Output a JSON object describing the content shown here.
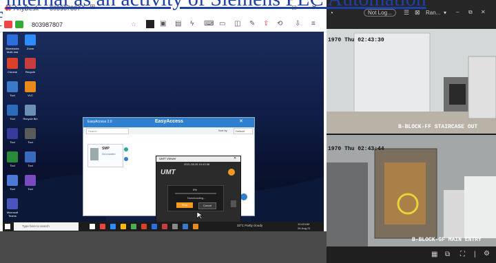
{
  "overlay": {
    "line1": "internal as an activity of Siemens PLC Automation",
    "line2": "f"
  },
  "anydesk": {
    "app_name": "AnyDesk",
    "session_id": "803987807",
    "address": "803987807"
  },
  "desktop": {
    "icons": [
      {
        "label": "Bluestacks Multi-Inst",
        "color": "#2a6fdb"
      },
      {
        "label": "Zoom",
        "color": "#2d8cff"
      },
      {
        "label": "Chrome",
        "color": "#d9412b"
      },
      {
        "label": "Recycle",
        "color": "#c73c3c"
      },
      {
        "label": "Tool",
        "color": "#3a7ac9"
      },
      {
        "label": "VLC",
        "color": "#e88a1a"
      },
      {
        "label": "Tool",
        "color": "#2c6bb8"
      },
      {
        "label": "Recycle Bin",
        "color": "#6c8fb5"
      },
      {
        "label": "Tool",
        "color": "#3a3a9a"
      },
      {
        "label": "Tool",
        "color": "#5a5a5a"
      },
      {
        "label": "Tool",
        "color": "#2a8a3a"
      },
      {
        "label": "Tool",
        "color": "#3a6ac0"
      },
      {
        "label": "Tool",
        "color": "#4a7ad8"
      },
      {
        "label": "Tool",
        "color": "#7a4ac0"
      },
      {
        "label": "Microsoft Teams",
        "color": "#4b53bc"
      }
    ],
    "taskbar": {
      "search_placeholder": "Type here to search",
      "weather": "33°C  Partly cloudy",
      "time": "10:43 AM",
      "date": "26-Aug-21"
    }
  },
  "easyaccess": {
    "title": "EasyAccess 2.0",
    "brand": "EasyAccess",
    "search_placeholder": "Search",
    "sort_label": "Sort by",
    "sort_value": "Default",
    "device_name": "SMP",
    "device_status": "Not Installed"
  },
  "umt": {
    "title": "UMT Viewer",
    "datetime": "2021-08-26 10:43:38",
    "logo": "UMT",
    "progress": "0%",
    "progress_value": 0,
    "status": "Downloading...",
    "primary_button": "Stop",
    "secondary_button": "Cancel"
  },
  "cctv": {
    "toolbar_not_logged": "Not Log...",
    "toolbar_ran": "Ran...",
    "cam1_time": "1970 Thu 02:43:30",
    "cam1_label": "B-BLOCK-FF STAIRCASE OUT",
    "cam2_time": "1970 Thu 02:43:44",
    "cam2_label": "B-BLOCK-GF MAIN ENTRY"
  }
}
